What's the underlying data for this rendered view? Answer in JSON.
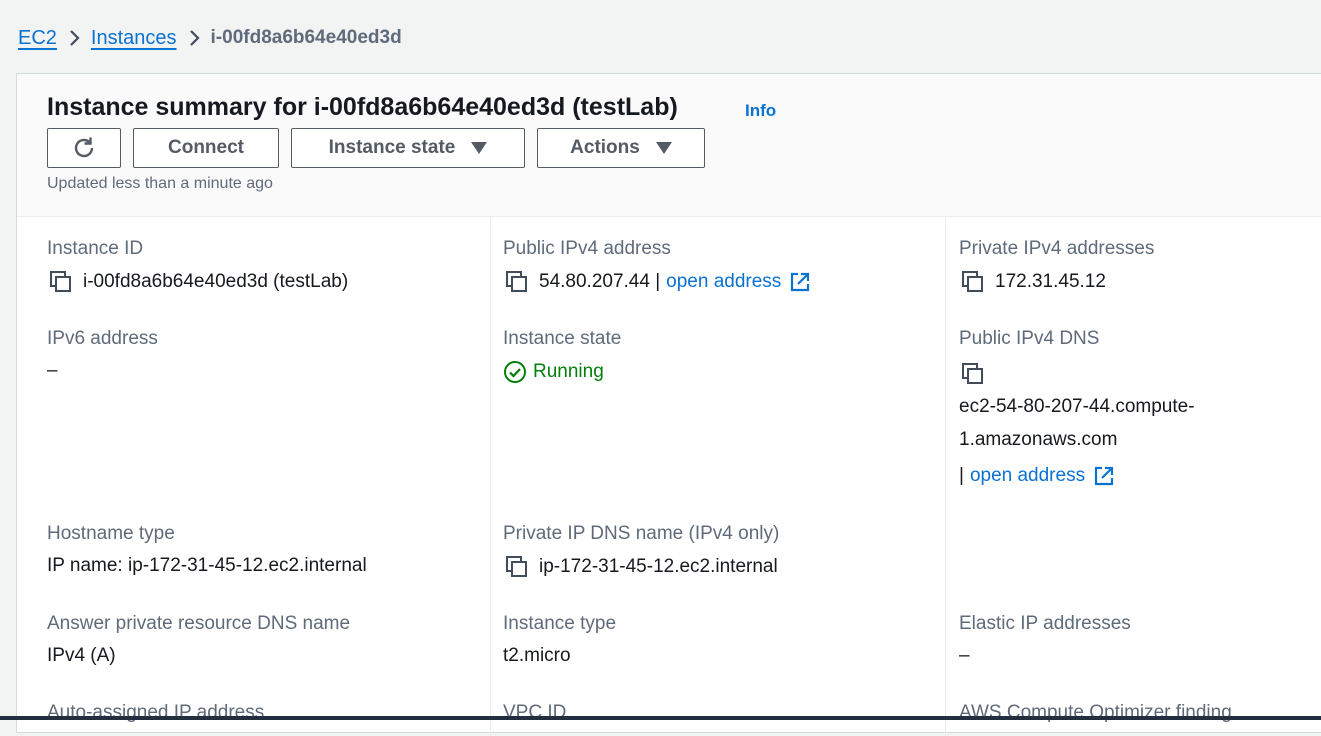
{
  "breadcrumb": {
    "items": [
      "EC2",
      "Instances"
    ],
    "current": "i-00fd8a6b64e40ed3d"
  },
  "summary": {
    "title": "Instance summary for i-00fd8a6b64e40ed3d (testLab)",
    "info_label": "Info",
    "buttons": {
      "refresh_icon": "refresh-icon",
      "connect": "Connect",
      "instance_state": "Instance state",
      "actions": "Actions"
    },
    "updated": "Updated less than a minute ago"
  },
  "details": {
    "instance_id": {
      "label": "Instance ID",
      "value": "i-00fd8a6b64e40ed3d (testLab)"
    },
    "public_ipv4": {
      "label": "Public IPv4 address",
      "value": "54.80.207.44 |",
      "link": "open address"
    },
    "private_ipv4": {
      "label": "Private IPv4 addresses",
      "value": "172.31.45.12"
    },
    "ipv6": {
      "label": "IPv6 address",
      "value": "–"
    },
    "instance_state": {
      "label": "Instance state",
      "value": "Running"
    },
    "public_dns": {
      "label": "Public IPv4 DNS",
      "value_line1": "ec2-54-80-207-44.compute-",
      "value_line2": "1.amazonaws.com",
      "separator": "|",
      "link": "open address"
    },
    "hostname_type": {
      "label": "Hostname type",
      "value": "IP name: ip-172-31-45-12.ec2.internal"
    },
    "private_dns": {
      "label": "Private IP DNS name (IPv4 only)",
      "value": "ip-172-31-45-12.ec2.internal"
    },
    "answer_dns": {
      "label": "Answer private resource DNS name",
      "value": "IPv4 (A)"
    },
    "instance_type": {
      "label": "Instance type",
      "value": "t2.micro"
    },
    "elastic_ip": {
      "label": "Elastic IP addresses",
      "value": "–"
    },
    "auto_assigned": {
      "label": "Auto-assigned IP address"
    },
    "vpc_id": {
      "label": "VPC ID"
    },
    "optimizer": {
      "label": "AWS Compute Optimizer finding"
    }
  },
  "colors": {
    "link": "#0972d3",
    "running": "#037f0c",
    "label": "#5f6b7a",
    "header_bg": "#fafafa"
  }
}
